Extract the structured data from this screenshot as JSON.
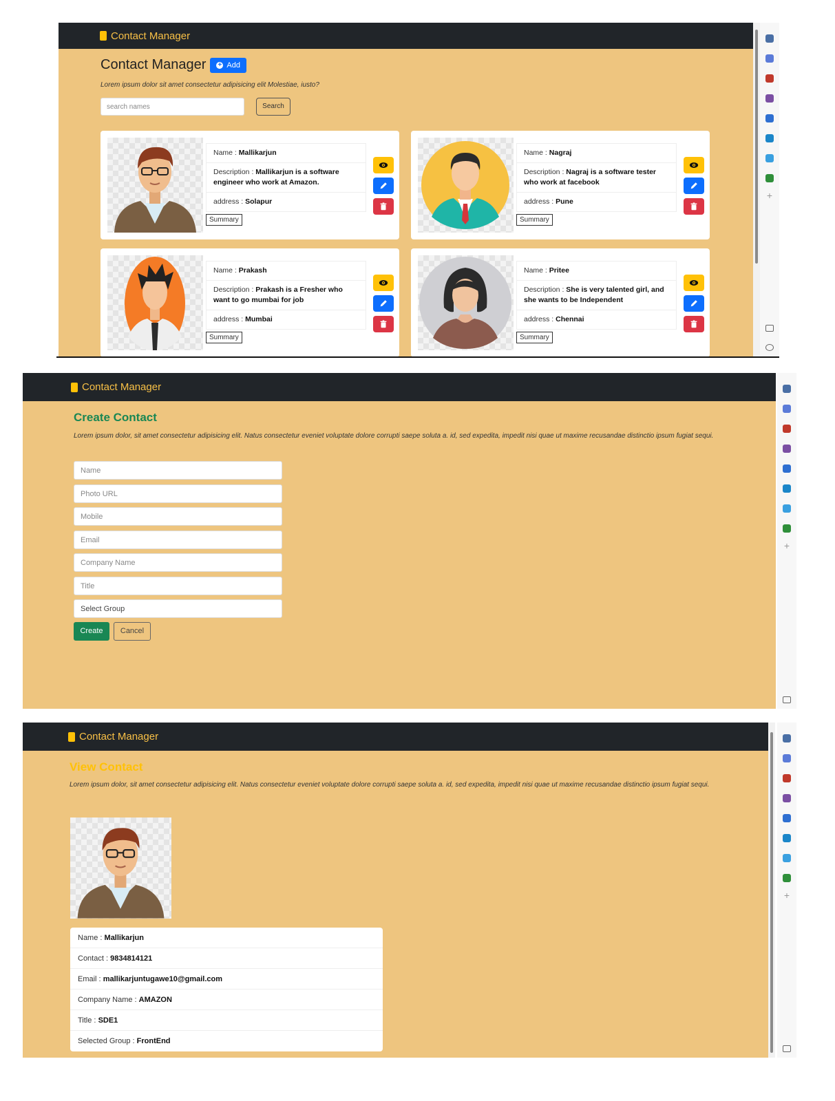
{
  "brand": "Contact Manager",
  "colors": {
    "navbar": "#212529",
    "page": "#eec57f",
    "primary": "#0d6efd",
    "warning": "#ffc107",
    "danger": "#dc3545",
    "success": "#198754",
    "create_title": "#198754",
    "view_title": "#ffc107"
  },
  "list_page": {
    "title": "Contact Manager",
    "add_label": "Add",
    "lead": "Lorem ipsum dolor sit amet consectetur adipisicing elit Molestiae, iusto?",
    "search_placeholder": "search names",
    "search_label": "Search",
    "contacts": [
      {
        "name_label": "Name :",
        "name": "Mallikarjun",
        "desc_label": "Description :",
        "desc": "Mallikarjun is a software engineer who work at Amazon.",
        "address_label": "address :",
        "address": "Solapur",
        "summary": "Summary",
        "avatar": "man-glasses-brown-jacket"
      },
      {
        "name_label": "Name :",
        "name": "Nagraj",
        "desc_label": "Description :",
        "desc": "Nagraj is a software tester who work at facebook",
        "address_label": "address :",
        "address": "Pune",
        "summary": "Summary",
        "avatar": "man-teal-suit-yellow-circle"
      },
      {
        "name_label": "Name :",
        "name": "Prakash",
        "desc_label": "Description :",
        "desc": "Prakash is a Fresher who want to go mumbai for job",
        "address_label": "address :",
        "address": "Mumbai",
        "summary": "Summary",
        "avatar": "man-orange-oval"
      },
      {
        "name_label": "Name :",
        "name": "Pritee",
        "desc_label": "Description :",
        "desc": "She is very talented girl, and she wants to be Independent",
        "address_label": "address :",
        "address": "Chennai",
        "summary": "Summary",
        "avatar": "woman-grey-circle"
      }
    ]
  },
  "create_page": {
    "title": "Create Contact",
    "lead": "Lorem ipsum dolor, sit amet consectetur adipisicing elit. Natus consectetur eveniet voluptate dolore corrupti saepe soluta a. id, sed expedita, impedit nisi quae ut maxime recusandae distinctio ipsum fugiat sequi.",
    "fields": [
      "Name",
      "Photo URL",
      "Mobile",
      "Email",
      "Company Name",
      "Title",
      "Select Group"
    ],
    "create_label": "Create",
    "cancel_label": "Cancel"
  },
  "view_page": {
    "title": "View Contact",
    "lead": "Lorem ipsum dolor, sit amet consectetur adipisicing elit. Natus consectetur eveniet voluptate dolore corrupti saepe soluta a. id, sed expedita, impedit nisi quae ut maxime recusandae distinctio ipsum fugiat sequi.",
    "details": [
      {
        "label": "Name :",
        "value": "Mallikarjun"
      },
      {
        "label": "Contact :",
        "value": "9834814121"
      },
      {
        "label": "Email :",
        "value": "mallikarjuntugawe10@gmail.com"
      },
      {
        "label": "Company Name :",
        "value": "AMAZON"
      },
      {
        "label": "Title :",
        "value": "SDE1"
      },
      {
        "label": "Selected Group :",
        "value": "FrontEnd"
      }
    ]
  }
}
